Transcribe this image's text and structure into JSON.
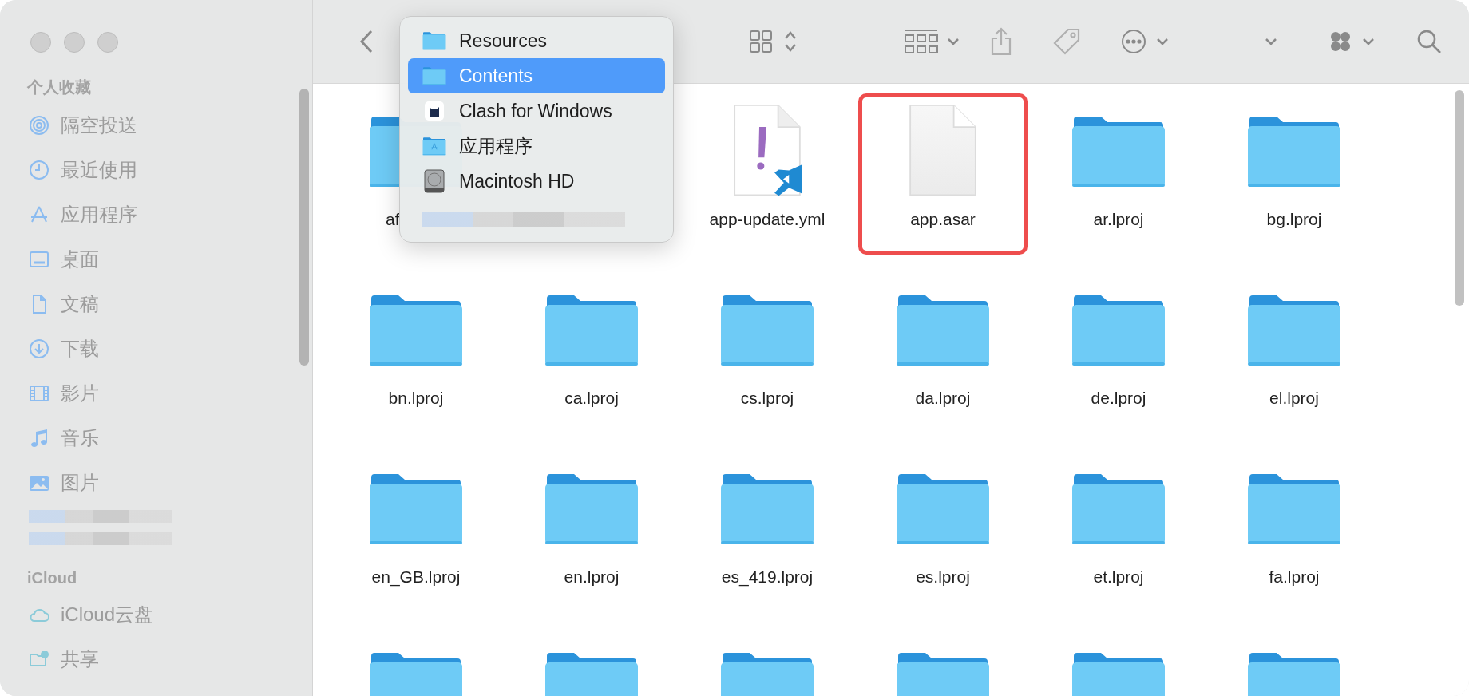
{
  "sidebar": {
    "sections": [
      {
        "title": "个人收藏",
        "items": [
          {
            "label": "隔空投送",
            "kind": "airdrop",
            "selected": false
          },
          {
            "label": "最近使用",
            "kind": "recent",
            "selected": false
          },
          {
            "label": "应用程序",
            "kind": "apps",
            "selected": false
          },
          {
            "label": "桌面",
            "kind": "desktop",
            "selected": false
          },
          {
            "label": "文稿",
            "kind": "document",
            "selected": false
          },
          {
            "label": "下载",
            "kind": "download",
            "selected": false
          },
          {
            "label": "影片",
            "kind": "movies",
            "selected": false
          },
          {
            "label": "音乐",
            "kind": "music",
            "selected": false
          },
          {
            "label": "图片",
            "kind": "pictures",
            "selected": false
          },
          {
            "kind": "redacted",
            "selected": false
          },
          {
            "kind": "redacted",
            "selected": false
          }
        ]
      },
      {
        "title": "iCloud",
        "items": [
          {
            "label": "iCloud云盘",
            "kind": "cloud",
            "selected": false
          },
          {
            "label": "共享",
            "kind": "shared",
            "selected": false
          }
        ]
      }
    ]
  },
  "path_menu": {
    "items": [
      {
        "label": "Resources",
        "kind": "folder",
        "selected": false
      },
      {
        "label": "Contents",
        "kind": "folder",
        "selected": true
      },
      {
        "label": "Clash for Windows",
        "kind": "app",
        "selected": false
      },
      {
        "label": "应用程序",
        "kind": "apps-folder",
        "selected": false
      },
      {
        "label": "Macintosh HD",
        "kind": "disk",
        "selected": false
      },
      {
        "kind": "redacted",
        "selected": false
      }
    ]
  },
  "files": [
    {
      "label": "af",
      "kind": "folder-partial",
      "highlighted": false
    },
    {
      "kind": "covered",
      "highlighted": false
    },
    {
      "label": "app-update.yml",
      "kind": "yml",
      "highlighted": false
    },
    {
      "label": "app.asar",
      "kind": "document",
      "highlighted": true
    },
    {
      "label": "ar.lproj",
      "kind": "folder",
      "highlighted": false
    },
    {
      "label": "bg.lproj",
      "kind": "folder",
      "highlighted": false
    },
    {
      "label": "bn.lproj",
      "kind": "folder",
      "highlighted": false
    },
    {
      "label": "ca.lproj",
      "kind": "folder",
      "highlighted": false
    },
    {
      "label": "cs.lproj",
      "kind": "folder",
      "highlighted": false
    },
    {
      "label": "da.lproj",
      "kind": "folder",
      "highlighted": false
    },
    {
      "label": "de.lproj",
      "kind": "folder",
      "highlighted": false
    },
    {
      "label": "el.lproj",
      "kind": "folder",
      "highlighted": false
    },
    {
      "label": "en_GB.lproj",
      "kind": "folder",
      "highlighted": false
    },
    {
      "label": "en.lproj",
      "kind": "folder",
      "highlighted": false
    },
    {
      "label": "es_419.lproj",
      "kind": "folder",
      "highlighted": false
    },
    {
      "label": "es.lproj",
      "kind": "folder",
      "highlighted": false
    },
    {
      "label": "et.lproj",
      "kind": "folder",
      "highlighted": false
    },
    {
      "label": "fa.lproj",
      "kind": "folder",
      "highlighted": false
    },
    {
      "kind": "folder",
      "highlighted": false
    },
    {
      "kind": "folder",
      "highlighted": false
    },
    {
      "kind": "folder",
      "highlighted": false
    },
    {
      "kind": "folder",
      "highlighted": false
    },
    {
      "kind": "folder",
      "highlighted": false
    },
    {
      "kind": "folder",
      "highlighted": false
    }
  ]
}
